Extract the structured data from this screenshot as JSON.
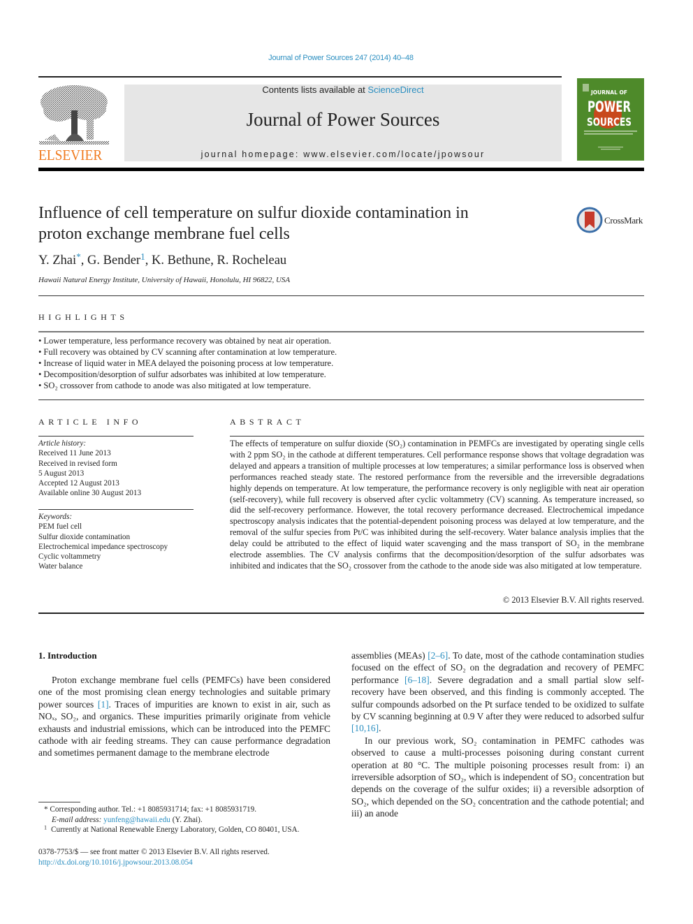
{
  "running_head": "Journal of Power Sources 247 (2014) 40–48",
  "masthead": {
    "contents_prefix": "Contents lists available at ",
    "contents_link": "ScienceDirect",
    "journal_name": "Journal of Power Sources",
    "homepage": "journal homepage: www.elsevier.com/locate/jpowsour",
    "publisher_wordmark": "ELSEVIER",
    "publisher_logo_icon": "elsevier-tree-icon",
    "cover_icon": "journal-cover-icon",
    "cover_title_top": "JOURNAL OF",
    "cover_title_mid": "POWER",
    "cover_title_bottom": "SOURCES",
    "colors": {
      "brand_orange": "#f07a1e",
      "link_blue": "#2a8ec0",
      "cover_green": "#4e8a2a",
      "masthead_gray": "#e6e6e6"
    }
  },
  "article": {
    "title_line1": "Influence of cell temperature on sulfur dioxide contamination in",
    "title_line2": "proton exchange membrane fuel cells",
    "crossmark_label": "CrossMark",
    "authors": [
      {
        "name": "Y. Zhai",
        "mark": "*"
      },
      {
        "name": "G. Bender",
        "mark": "1"
      },
      {
        "name": "K. Bethune",
        "mark": ""
      },
      {
        "name": "R. Rocheleau",
        "mark": ""
      }
    ],
    "affiliation": "Hawaii Natural Energy Institute, University of Hawaii, Honolulu, HI 96822, USA"
  },
  "highlights": {
    "heading": "HIGHLIGHTS",
    "items": [
      "Lower temperature, less performance recovery was obtained by neat air operation.",
      "Full recovery was obtained by CV scanning after contamination at low temperature.",
      "Increase of liquid water in MEA delayed the poisoning process at low temperature.",
      "Decomposition/desorption of sulfur adsorbates was inhibited at low temperature.",
      "SO₂ crossover from cathode to anode was also mitigated at low temperature."
    ]
  },
  "article_info": {
    "heading": "ARTICLE INFO",
    "history_label": "Article history:",
    "history": [
      "Received 11 June 2013",
      "Received in revised form",
      "5 August 2013",
      "Accepted 12 August 2013",
      "Available online 30 August 2013"
    ],
    "keywords_label": "Keywords:",
    "keywords": [
      "PEM fuel cell",
      "Sulfur dioxide contamination",
      "Electrochemical impedance spectroscopy",
      "Cyclic voltammetry",
      "Water balance"
    ]
  },
  "abstract": {
    "heading": "ABSTRACT",
    "text": "The effects of temperature on sulfur dioxide (SO₂) contamination in PEMFCs are investigated by operating single cells with 2 ppm SO₂ in the cathode at different temperatures. Cell performance response shows that voltage degradation was delayed and appears a transition of multiple processes at low temperatures; a similar performance loss is observed when performances reached steady state. The restored performance from the reversible and the irreversible degradations highly depends on temperature. At low temperature, the performance recovery is only negligible with neat air operation (self-recovery), while full recovery is observed after cyclic voltammetry (CV) scanning. As temperature increased, so did the self-recovery performance. However, the total recovery performance decreased. Electrochemical impedance spectroscopy analysis indicates that the potential-dependent poisoning process was delayed at low temperature, and the removal of the sulfur species from Pt/C was inhibited during the self-recovery. Water balance analysis implies that the delay could be attributed to the effect of liquid water scavenging and the mass transport of SO₂ in the membrane electrode assemblies. The CV analysis confirms that the decomposition/desorption of the sulfur adsorbates was inhibited and indicates that the SO₂ crossover from the cathode to the anode side was also mitigated at low temperature.",
    "copyright": "© 2013 Elsevier B.V. All rights reserved."
  },
  "introduction": {
    "heading": "1.  Introduction",
    "left_column": {
      "p1_a": "Proton exchange membrane fuel cells (PEMFCs) have been considered one of the most promising clean energy technologies and suitable primary power sources ",
      "p1_cite1": "[1]",
      "p1_b": ". Traces of impurities are known to exist in air, such as NOₓ, SO₂, and organics. These impurities primarily originate from vehicle exhausts and industrial emissions, which can be introduced into the PEMFC cathode with air feeding streams. They can cause performance degradation and sometimes permanent damage to the membrane electrode"
    },
    "right_column": {
      "p1_a": "assemblies (MEAs) ",
      "p1_cite1": "[2–6]",
      "p1_b": ". To date, most of the cathode contamination studies focused on the effect of SO₂ on the degradation and recovery of PEMFC performance ",
      "p1_cite2": "[6–18]",
      "p1_c": ". Severe degradation and a small partial slow self-recovery have been observed, and this finding is commonly accepted. The sulfur compounds adsorbed on the Pt surface tended to be oxidized to sulfate by CV scanning beginning at 0.9 V after they were reduced to adsorbed sulfur ",
      "p1_cite3": "[10,16]",
      "p1_d": ".",
      "p2": "In our previous work, SO₂ contamination in PEMFC cathodes was observed to cause a multi-processes poisoning during constant current operation at 80 °C. The multiple poisoning processes result from: i) an irreversible adsorption of SO₂, which is independent of SO₂ concentration but depends on the coverage of the sulfur oxides; ii) a reversible adsorption of SO₂, which depended on the SO₂ concentration and the cathode potential; and iii) an anode"
    }
  },
  "footnotes": {
    "corresponding": "* Corresponding author. Tel.: +1 8085931714; fax: +1 8085931719.",
    "email_label": "E-mail address: ",
    "email": "yunfeng@hawaii.edu",
    "email_suffix": " (Y. Zhai).",
    "note1_mark": "1",
    "note1": "Currently at National Renewable Energy Laboratory, Golden, CO 80401, USA.",
    "front_matter": "0378-7753/$ — see front matter © 2013 Elsevier B.V. All rights reserved.",
    "doi": "http://dx.doi.org/10.1016/j.jpowsour.2013.08.054"
  }
}
